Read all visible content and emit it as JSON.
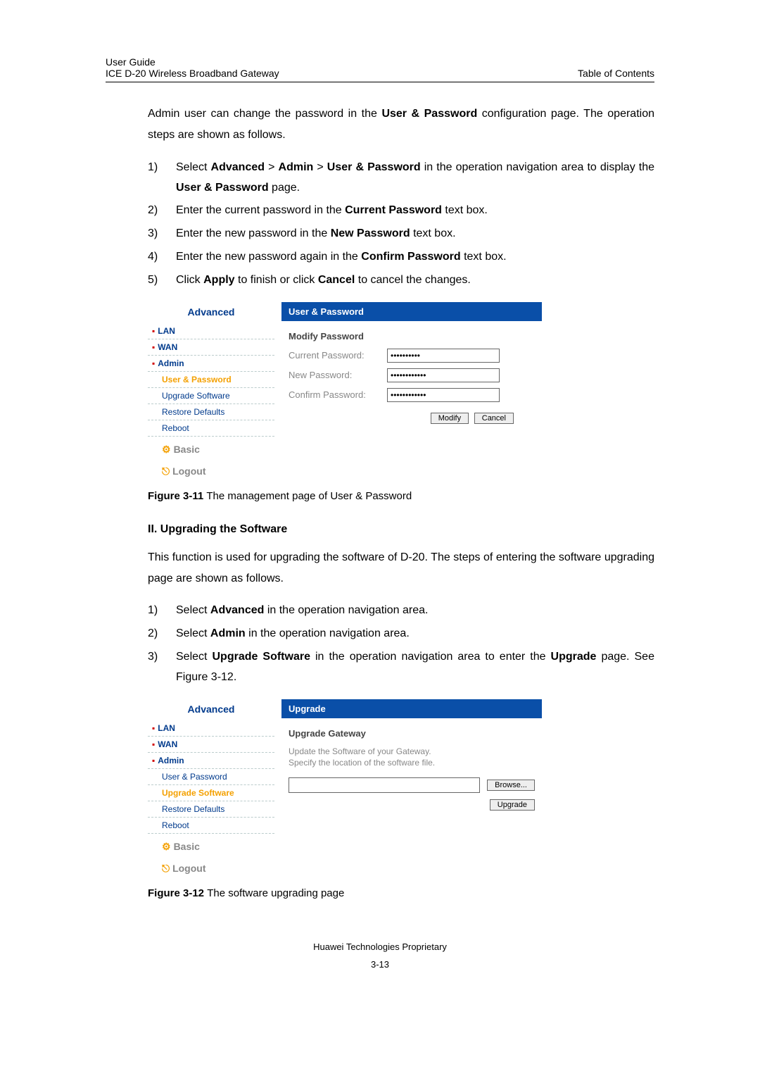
{
  "header": {
    "line1": "User Guide",
    "line2": "ICE D-20 Wireless Broadband Gateway",
    "right": "Table of Contents"
  },
  "intro_para": {
    "pre": "Admin user can change the password in the ",
    "bold1": "User & Password",
    "post": " configuration page. The operation steps are shown as follows."
  },
  "steps1": [
    {
      "n": "1)",
      "parts": [
        {
          "t": "Select "
        },
        {
          "b": "Advanced"
        },
        {
          "t": " > "
        },
        {
          "b": "Admin"
        },
        {
          "t": " > "
        },
        {
          "b": "User & Password"
        },
        {
          "t": " in the operation navigation area to display the "
        },
        {
          "b": "User & Password"
        },
        {
          "t": " page."
        }
      ]
    },
    {
      "n": "2)",
      "parts": [
        {
          "t": "Enter the current password in the "
        },
        {
          "b": "Current Password"
        },
        {
          "t": " text box."
        }
      ]
    },
    {
      "n": "3)",
      "parts": [
        {
          "t": "Enter the new password in the "
        },
        {
          "b": "New Password"
        },
        {
          "t": " text box."
        }
      ]
    },
    {
      "n": "4)",
      "parts": [
        {
          "t": "Enter the new password again in the "
        },
        {
          "b": "Confirm Password"
        },
        {
          "t": " text box."
        }
      ]
    },
    {
      "n": "5)",
      "parts": [
        {
          "t": "Click "
        },
        {
          "b": "Apply"
        },
        {
          "t": " to finish or click "
        },
        {
          "b": "Cancel"
        },
        {
          "t": " to cancel the changes."
        }
      ]
    }
  ],
  "screenshot1": {
    "nav_title": "Advanced",
    "nav": {
      "lan": "LAN",
      "wan": "WAN",
      "admin": "Admin",
      "user_pwd": "User & Password",
      "upgrade": "Upgrade Software",
      "restore": "Restore Defaults",
      "reboot": "Reboot",
      "basic": "Basic",
      "logout": "Logout"
    },
    "bar": "User & Password",
    "panel_title": "Modify Password",
    "labels": {
      "current": "Current Password:",
      "new": "New Password:",
      "confirm": "Confirm Password:"
    },
    "values": {
      "current": "••••••••••",
      "new": "••••••••••••",
      "confirm": "••••••••••••"
    },
    "btn_modify": "Modify",
    "btn_cancel": "Cancel"
  },
  "fig1": {
    "b": "Figure 3-11 ",
    "t": "The management page of User & Password"
  },
  "sec2_heading": "II. Upgrading the Software",
  "sec2_para": "This function is used for upgrading the software of D-20. The steps of entering the software upgrading page are shown as follows.",
  "steps2": [
    {
      "n": "1)",
      "parts": [
        {
          "t": "Select "
        },
        {
          "b": "Advanced"
        },
        {
          "t": " in the operation navigation area."
        }
      ]
    },
    {
      "n": "2)",
      "parts": [
        {
          "t": "Select "
        },
        {
          "b": "Admin"
        },
        {
          "t": " in the operation navigation area."
        }
      ]
    },
    {
      "n": "3)",
      "parts": [
        {
          "t": "Select "
        },
        {
          "b": "Upgrade Software"
        },
        {
          "t": " in the operation navigation area to enter the "
        },
        {
          "b": "Upgrade"
        },
        {
          "t": " page. See Figure 3-12."
        }
      ]
    }
  ],
  "screenshot2": {
    "nav_title": "Advanced",
    "nav": {
      "lan": "LAN",
      "wan": "WAN",
      "admin": "Admin",
      "user_pwd": "User & Password",
      "upgrade": "Upgrade Software",
      "restore": "Restore Defaults",
      "reboot": "Reboot",
      "basic": "Basic",
      "logout": "Logout"
    },
    "bar": "Upgrade",
    "panel_title": "Upgrade Gateway",
    "desc1": "Update the Software of your Gateway.",
    "desc2": "Specify the location of the software file.",
    "btn_browse": "Browse...",
    "btn_upgrade": "Upgrade"
  },
  "fig2": {
    "b": "Figure 3-12 ",
    "t": "The software upgrading page"
  },
  "footer": {
    "line": "Huawei Technologies Proprietary",
    "pnum": "3-13"
  }
}
